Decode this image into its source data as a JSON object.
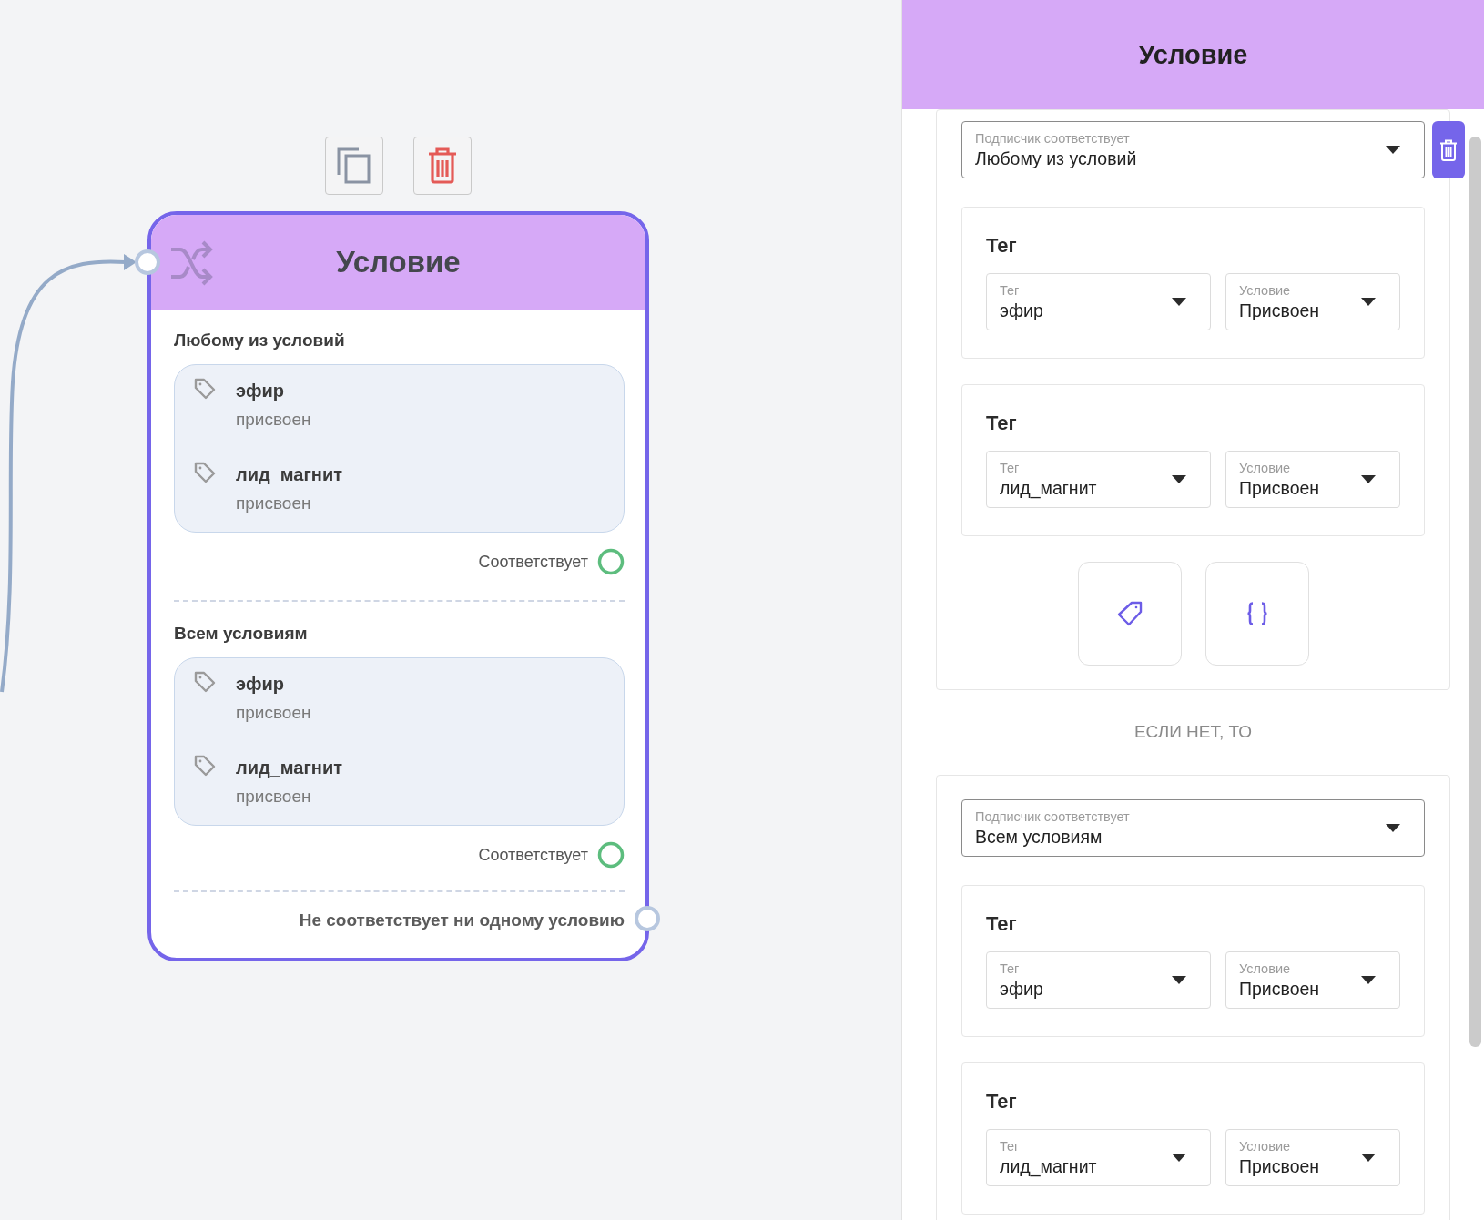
{
  "node": {
    "title": "Условие",
    "groups": [
      {
        "heading": "Любому из условий",
        "conditions": [
          {
            "tag": "эфир",
            "state": "присвоен"
          },
          {
            "tag": "лид_магнит",
            "state": "присвоен"
          }
        ],
        "output_label": "Соответствует"
      },
      {
        "heading": "Всем условиям",
        "conditions": [
          {
            "tag": "эфир",
            "state": "присвоен"
          },
          {
            "tag": "лид_магнит",
            "state": "присвоен"
          }
        ],
        "output_label": "Соответствует"
      }
    ],
    "fallback_label": "Не соответствует ни одному условию"
  },
  "panel": {
    "title": "Условие",
    "blocks": [
      {
        "match_label": "Подписчик соответствует",
        "match_value": "Любому из условий",
        "deletable": true,
        "rules": [
          {
            "heading": "Тег",
            "tag_label": "Тег",
            "tag_value": "эфир",
            "condition_label": "Условие",
            "condition_value": "Присвоен"
          },
          {
            "heading": "Тег",
            "tag_label": "Тег",
            "tag_value": "лид_магнит",
            "condition_label": "Условие",
            "condition_value": "Присвоен"
          }
        ],
        "add_buttons": [
          {
            "kind": "tag"
          },
          {
            "kind": "code"
          }
        ]
      },
      {
        "match_label": "Подписчик соответствует",
        "match_value": "Всем условиям",
        "deletable": false,
        "rules": [
          {
            "heading": "Тег",
            "tag_label": "Тег",
            "tag_value": "эфир",
            "condition_label": "Условие",
            "condition_value": "Присвоен"
          },
          {
            "heading": "Тег",
            "tag_label": "Тег",
            "tag_value": "лид_магнит",
            "condition_label": "Условие",
            "condition_value": "Присвоен"
          }
        ]
      }
    ],
    "separator": "ЕСЛИ НЕТ, ТО"
  }
}
